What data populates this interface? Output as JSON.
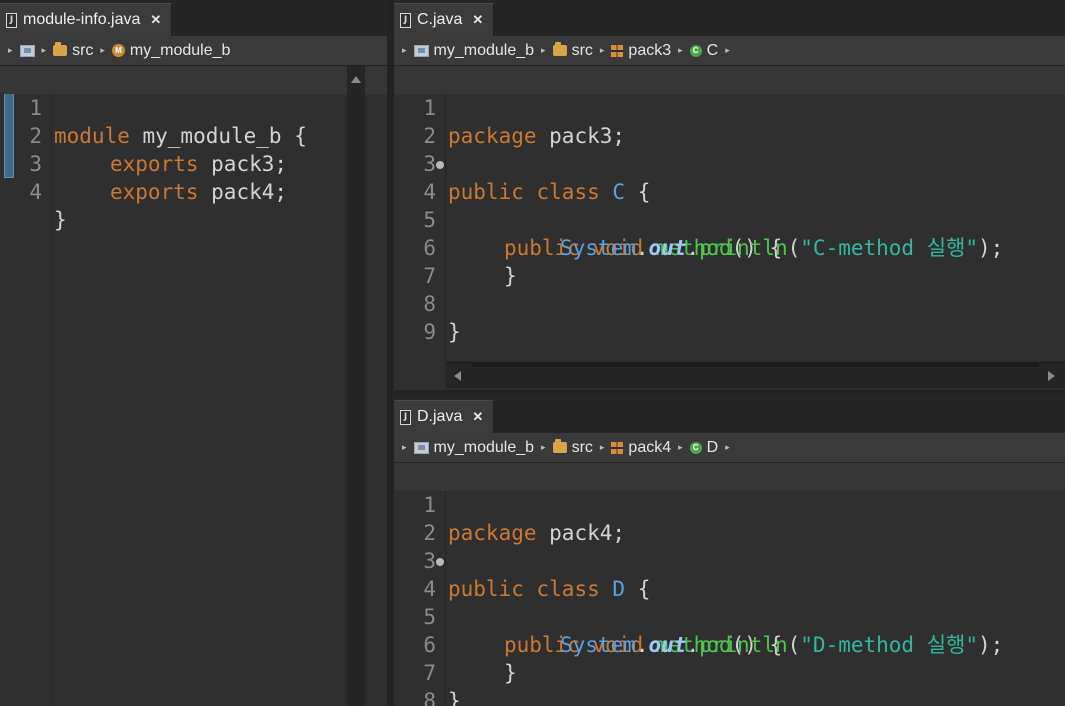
{
  "editors": {
    "module_info": {
      "tab_label": "module-info.java",
      "file_icon": "J",
      "crumbs": [
        "src",
        "my_module_b"
      ],
      "crumb_icons": [
        "package-folder-icon",
        "module-icon"
      ],
      "line_numbers": [
        "1",
        "2",
        "3",
        "4"
      ]
    },
    "c_java": {
      "tab_label": "C.java",
      "file_icon": "J",
      "crumbs": [
        "my_module_b",
        "src",
        "pack3",
        "C"
      ],
      "line_numbers": [
        "1",
        "2",
        "3",
        "4",
        "5",
        "6",
        "7",
        "8",
        "9"
      ]
    },
    "d_java": {
      "tab_label": "D.java",
      "file_icon": "J",
      "crumbs": [
        "my_module_b",
        "src",
        "pack4",
        "D"
      ],
      "line_numbers": [
        "1",
        "2",
        "3",
        "4",
        "5",
        "6",
        "7",
        "8"
      ]
    }
  },
  "code": {
    "module_info": {
      "l1_kw": "module",
      "l1_rest": " my_module_b {",
      "l2_kw": "exports",
      "l2_rest": " pack3;",
      "l3_kw": "exports",
      "l3_rest": " pack4;",
      "l4": "}"
    },
    "c_java": {
      "l1_kw": "package",
      "l1_rest": " pack3;",
      "l3_kw1": "public",
      "l3_kw2": "class",
      "l3_ty": "C",
      "l3_rest": " {",
      "l4_kw1": "public",
      "l4_kw2": "void",
      "l4_fn": "method",
      "l4_rest": "() {",
      "l5_ty": "System",
      "l5_dot1": ".",
      "l5_fld": "out",
      "l5_dot2": ".",
      "l5_fn": "println",
      "l5_open": "(",
      "l5_str": "\"C-method 실행\"",
      "l5_close": ");",
      "l6": "}",
      "l8": "}"
    },
    "d_java": {
      "l1_kw": "package",
      "l1_rest": " pack4;",
      "l3_kw1": "public",
      "l3_kw2": "class",
      "l3_ty": "D",
      "l3_rest": " {",
      "l4_kw1": "public",
      "l4_kw2": "void",
      "l4_fn": "method",
      "l4_rest": "() {",
      "l5_ty": "System",
      "l5_dot1": ".",
      "l5_fld": "out",
      "l5_dot2": ".",
      "l5_fn": "println",
      "l5_open": "(",
      "l5_str": "\"D-method 실행\"",
      "l5_close": ");",
      "l6": "}",
      "l7": "}"
    }
  },
  "colors": {
    "keyword": "#cc7832",
    "type": "#5ba0e0",
    "method": "#4ec54e",
    "field": "#9cc8ff",
    "string": "#32b8a0",
    "background": "#2f2f2f"
  }
}
